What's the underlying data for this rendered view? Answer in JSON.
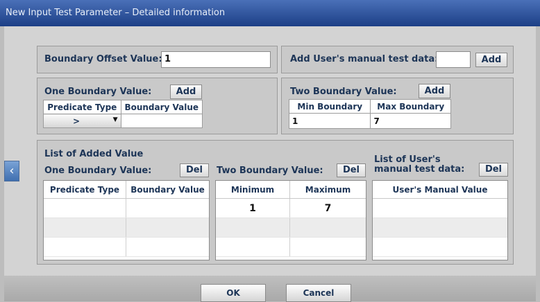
{
  "window": {
    "title": "New Input Test Parameter – Detailed information"
  },
  "boundary_offset": {
    "label": "Boundary Offset Value:",
    "value": "1"
  },
  "manual_entry": {
    "label": "Add User's manual test data:",
    "value": "",
    "add_label": "Add"
  },
  "one_boundary": {
    "label": "One Boundary Value:",
    "add_label": "Add",
    "col_predicate": "Predicate Type",
    "col_value": "Boundary Value",
    "predicate_selected": ">",
    "boundary_value": ""
  },
  "two_boundary": {
    "label": "Two Boundary Value:",
    "add_label": "Add",
    "col_min": "Min Boundary",
    "col_max": "Max Boundary",
    "min_value": "1",
    "max_value": "7"
  },
  "added": {
    "title": "List of Added Value",
    "one": {
      "label": "One Boundary Value:",
      "del_label": "Del",
      "col_predicate": "Predicate Type",
      "col_value": "Boundary Value"
    },
    "two": {
      "label": "Two Boundary Value:",
      "del_label": "Del",
      "col_min": "Minimum",
      "col_max": "Maximum",
      "rows": [
        {
          "min": "1",
          "max": "7"
        }
      ]
    },
    "manual": {
      "label_line1": "List of User's",
      "label_line2": "manual test data:",
      "del_label": "Del",
      "col": "User's Manual Value"
    }
  },
  "nav": {
    "prev_icon": "chevron-left-icon",
    "prev_glyph": "‹"
  },
  "buttons": {
    "ok": "OK",
    "cancel": "Cancel"
  }
}
